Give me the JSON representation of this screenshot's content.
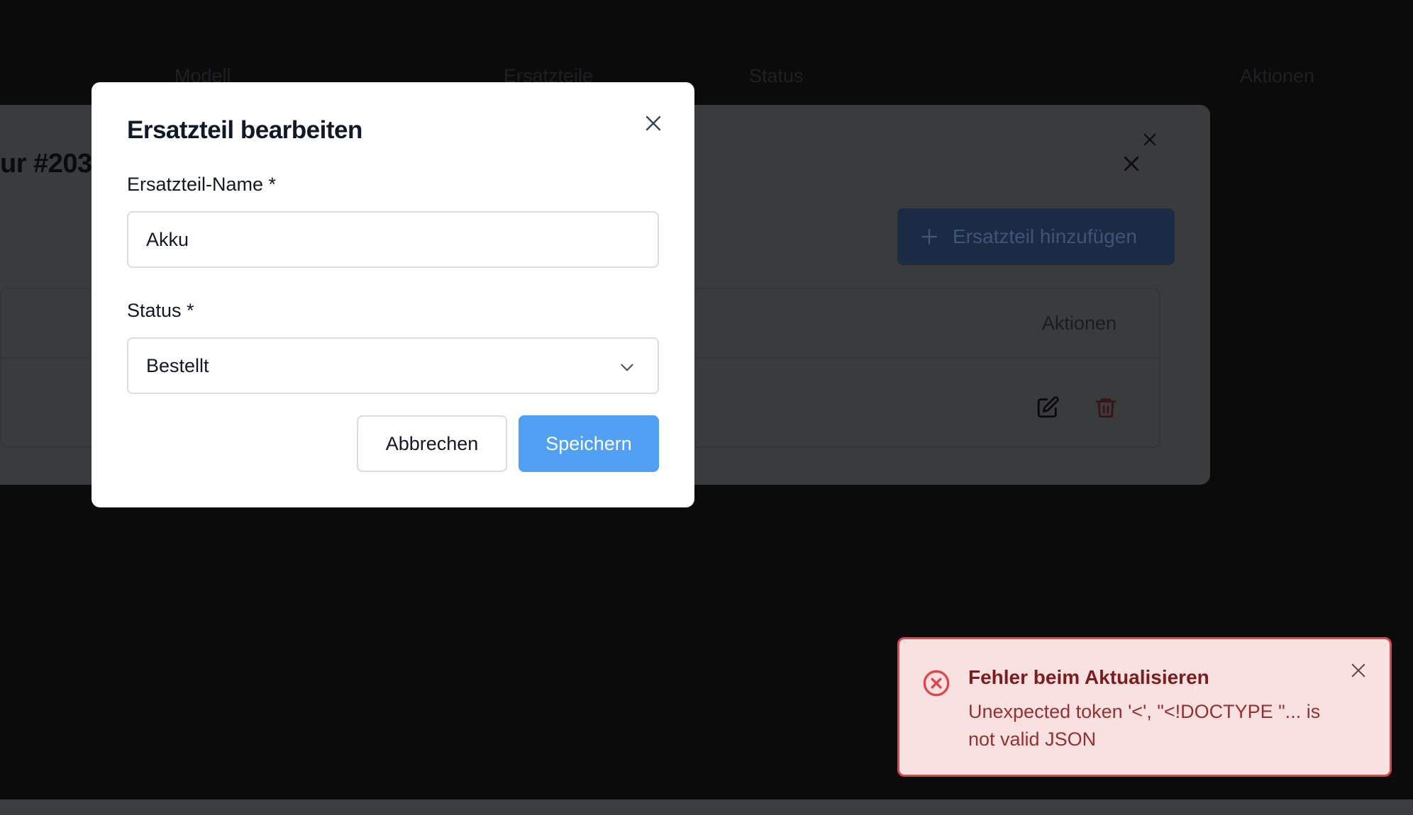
{
  "background": {
    "table_headers": [
      "Modell",
      "Ersatzteile",
      "Status",
      "Aktionen"
    ]
  },
  "underlying_dialog": {
    "title": "ur #203",
    "add_button_label": "Ersatzteil hinzufügen",
    "table_header_actions": "Aktionen"
  },
  "modal": {
    "title": "Ersatzteil bearbeiten",
    "name_label": "Ersatzteil-Name *",
    "name_value": "Akku",
    "status_label": "Status *",
    "status_value": "Bestellt",
    "cancel_label": "Abbrechen",
    "save_label": "Speichern"
  },
  "toast": {
    "title": "Fehler beim Aktualisieren",
    "message": "Unexpected token '<', \"<!DOCTYPE \"... is not valid JSON"
  },
  "colors": {
    "primary": "#52a0f5",
    "error_border": "#e0454a",
    "error_bg": "#f9e1e1",
    "error_title": "#7b1d1d",
    "delete_icon": "#b32424"
  }
}
